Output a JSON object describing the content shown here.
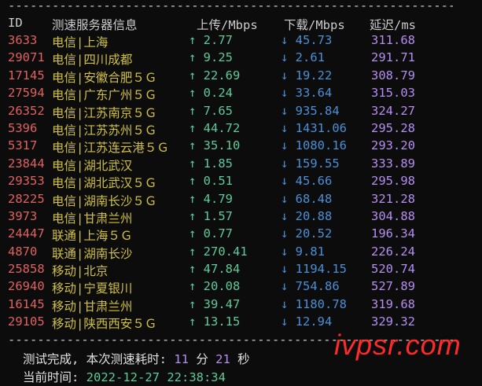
{
  "divider": "------------------------------------------------------------------------------------",
  "header": {
    "id": "ID",
    "server": "测速服务器信息",
    "upload": "上传/Mbps",
    "download": "下载/Mbps",
    "latency": "延迟/ms"
  },
  "rows": [
    {
      "id": "3633",
      "isp": "电信|上海",
      "up": "↑ 2.77",
      "down": "↓ 45.73",
      "latency": "311.68"
    },
    {
      "id": "29071",
      "isp": "电信|四川成都",
      "up": "↑ 9.25",
      "down": "↓ 2.61",
      "latency": "291.71"
    },
    {
      "id": "17145",
      "isp": "电信|安徽合肥５Ｇ",
      "up": "↑ 22.69",
      "down": "↓ 19.22",
      "latency": "308.79"
    },
    {
      "id": "27594",
      "isp": "电信|广东广州５Ｇ",
      "up": "↑ 0.24",
      "down": "↓ 33.64",
      "latency": "315.03"
    },
    {
      "id": "26352",
      "isp": "电信|江苏南京５Ｇ",
      "up": "↑ 7.65",
      "down": "↓ 935.84",
      "latency": "324.27"
    },
    {
      "id": "5396",
      "isp": "电信|江苏苏州５Ｇ",
      "up": "↑ 44.72",
      "down": "↓ 1431.06",
      "latency": "295.28"
    },
    {
      "id": "5317",
      "isp": "电信|江苏连云港５Ｇ",
      "up": "↑ 35.10",
      "down": "↓ 1080.16",
      "latency": "293.20"
    },
    {
      "id": "23844",
      "isp": "电信|湖北武汉",
      "up": "↑ 1.85",
      "down": "↓ 159.55",
      "latency": "333.89"
    },
    {
      "id": "29353",
      "isp": "电信|湖北武汉５Ｇ",
      "up": "↑ 0.51",
      "down": "↓ 45.66",
      "latency": "295.98"
    },
    {
      "id": "28225",
      "isp": "电信|湖南长沙５Ｇ",
      "up": "↑ 4.79",
      "down": "↓ 68.48",
      "latency": "321.28"
    },
    {
      "id": "3973",
      "isp": "电信|甘肃兰州",
      "up": "↑ 1.57",
      "down": "↓ 20.88",
      "latency": "304.88"
    },
    {
      "id": "24447",
      "isp": "联通|上海５Ｇ",
      "up": "↑ 0.77",
      "down": "↓ 20.52",
      "latency": "196.34"
    },
    {
      "id": "4870",
      "isp": "联通|湖南长沙",
      "up": "↑ 270.41",
      "down": "↓ 9.81",
      "latency": "226.24"
    },
    {
      "id": "25858",
      "isp": "移动|北京",
      "up": "↑ 47.84",
      "down": "↓ 1194.15",
      "latency": "520.74"
    },
    {
      "id": "26940",
      "isp": "移动|宁夏银川",
      "up": "↑ 20.08",
      "down": "↓ 754.86",
      "latency": "527.89"
    },
    {
      "id": "16145",
      "isp": "移动|甘肃兰州",
      "up": "↑ 39.47",
      "down": "↓ 1180.78",
      "latency": "319.68"
    },
    {
      "id": "29105",
      "isp": "移动|陕西西安５Ｇ",
      "up": "↑ 13.15",
      "down": "↓ 12.94",
      "latency": "329.32"
    }
  ],
  "footer": {
    "done_prefix": "测试完成, 本次测速耗时: ",
    "minutes": "11",
    "min_unit": " 分 ",
    "seconds": "21",
    "sec_unit": " 秒",
    "time_label": "当前时间: ",
    "time_value": "2022-12-27 22:38:34"
  },
  "watermark": "ivpsr.com"
}
